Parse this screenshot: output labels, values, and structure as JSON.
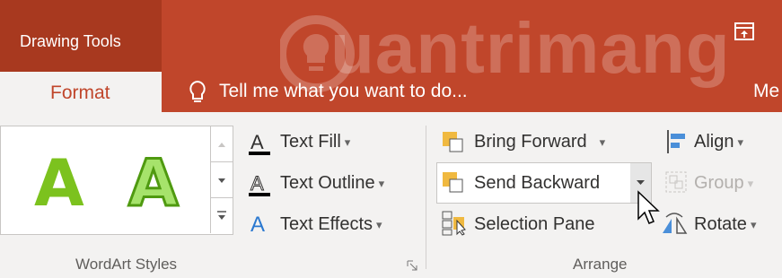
{
  "titlebar": {
    "context_tab": "Drawing Tools",
    "active_tab": "Format",
    "tell_me": "Tell me what you want to do...",
    "truncated_tab": "Me",
    "watermark": "uantrimang"
  },
  "wordart": {
    "letters": [
      "A",
      "A"
    ],
    "text_fill": "Text Fill",
    "text_outline": "Text Outline",
    "text_effects": "Text Effects",
    "group_label": "WordArt Styles"
  },
  "arrange": {
    "bring_forward": "Bring Forward",
    "send_backward": "Send Backward",
    "selection_pane": "Selection Pane",
    "align": "Align",
    "group": "Group",
    "rotate": "Rotate",
    "group_label": "Arrange"
  },
  "colors": {
    "accent": "#c0462b",
    "context_bg": "#a8391f",
    "wordart_green": "#7cc21e"
  }
}
